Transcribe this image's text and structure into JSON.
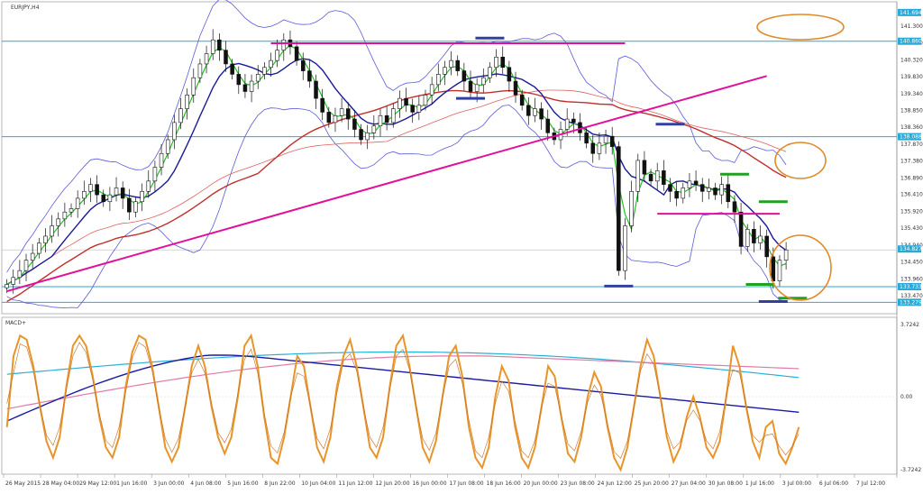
{
  "window": {
    "symbol_label": "EURJPY,H4",
    "macd_label": "MACD+"
  },
  "colors": {
    "up_candle": "#ffffff",
    "down_candle": "#111111",
    "bollinger": "#5a5adc",
    "ma_fast": "#22c022",
    "ma_mid": "#1a1a9a",
    "ma_slow": "#c0302a",
    "ma_slower": "#e06060",
    "trend_magenta": "#e0109a",
    "level_cyan": "#29a9d6",
    "ellipse_orange": "#e08a2a",
    "macd_orange": "#e8942a",
    "macd_blue": "#1a1aa0",
    "macd_cyan": "#29b0d6",
    "macd_pink": "#e07aa8"
  },
  "chart_data": [
    {
      "type": "line",
      "title": "EURJPY,H4",
      "price_axis_ticks": [
        "141.300",
        "140.810",
        "140.320",
        "139.830",
        "139.340",
        "138.850",
        "138.360",
        "137.870",
        "137.380",
        "136.890",
        "136.410",
        "135.920",
        "135.430",
        "134.940",
        "134.450",
        "133.960",
        "133.470"
      ],
      "price_tags": [
        "141.694",
        "140.860",
        "138.088",
        "134.827",
        "133.733",
        "133.279"
      ],
      "ylim": [
        133.0,
        141.9
      ],
      "time_axis_labels": [
        "26 May 2015",
        "28 May 04:00",
        "29 May 12:00",
        "1 Jun 16:00",
        "3 Jun 00:00",
        "4 Jun 08:00",
        "5 Jun 16:00",
        "8 Jun 22:00",
        "10 Jun 04:00",
        "11 Jun 12:00",
        "12 Jun 20:00",
        "16 Jun 00:00",
        "17 Jun 08:00",
        "18 Jun 16:00",
        "20 Jun 00:00",
        "23 Jun 08:00",
        "24 Jun 12:00",
        "25 Jun 20:00",
        "27 Jun 04:00",
        "30 Jun 08:00",
        "1 Jul 16:00",
        "3 Jul 00:00",
        "6 Jul 06:00",
        "7 Jul 12:00"
      ],
      "close_path": [
        133.8,
        134.0,
        134.2,
        134.5,
        134.7,
        135.0,
        135.2,
        135.5,
        135.7,
        135.9,
        136.0,
        136.3,
        136.5,
        136.7,
        136.4,
        136.2,
        136.4,
        136.6,
        136.3,
        135.9,
        136.2,
        136.5,
        136.8,
        137.2,
        137.6,
        138.0,
        138.5,
        138.9,
        139.3,
        139.8,
        140.2,
        140.5,
        140.9,
        140.6,
        140.2,
        139.9,
        139.6,
        139.4,
        139.7,
        139.9,
        140.1,
        140.3,
        140.6,
        140.9,
        140.7,
        140.3,
        140.0,
        139.7,
        139.2,
        138.8,
        138.5,
        138.7,
        138.9,
        138.6,
        138.3,
        138.0,
        138.2,
        138.4,
        138.7,
        138.5,
        138.9,
        139.2,
        139.0,
        138.8,
        139.0,
        139.3,
        139.6,
        139.9,
        140.1,
        140.3,
        140.0,
        139.7,
        139.4,
        139.6,
        139.8,
        140.1,
        140.4,
        140.1,
        139.7,
        139.3,
        139.0,
        138.7,
        138.9,
        138.6,
        138.2,
        138.0,
        138.3,
        138.6,
        138.5,
        138.2,
        137.9,
        137.6,
        137.9,
        138.1,
        137.8,
        134.2,
        135.5,
        136.5,
        137.4,
        137.0,
        136.8,
        137.1,
        136.7,
        136.5,
        136.3,
        136.6,
        136.8,
        136.7,
        136.5,
        136.6,
        136.4,
        136.7,
        136.2,
        135.9,
        134.9,
        135.4,
        135.0,
        135.2,
        134.6,
        133.9,
        134.5,
        134.8
      ],
      "series": [
        {
          "name": "",
          "kind": "bollinger_upper"
        },
        {
          "name": "",
          "kind": "bollinger_lower"
        },
        {
          "name": "",
          "kind": "ma_fast"
        },
        {
          "name": "",
          "kind": "ma_mid"
        },
        {
          "name": "",
          "kind": "ma_slow"
        },
        {
          "name": "",
          "kind": "ma_slower"
        }
      ],
      "annotations": {
        "resistance_levels": [
          140.86,
          138.088
        ],
        "support_levels": [
          133.733,
          133.279
        ],
        "trendline": {
          "from": [
            0,
            133.6
          ],
          "to": [
            118,
            139.85
          ]
        },
        "range_lines": [
          {
            "from": [
              41,
              140.8
            ],
            "to": [
              96,
              140.8
            ]
          },
          {
            "from": [
              101,
              135.85
            ],
            "to": [
              120,
              135.85
            ]
          }
        ]
      }
    },
    {
      "type": "line",
      "title": "MACD+",
      "ticks": [
        "3.7242",
        "0.00",
        "-3.7242"
      ],
      "ylim": [
        -3.7242,
        3.7242
      ],
      "oscillator": [
        -1.5,
        2.0,
        3.0,
        2.8,
        1.5,
        -0.5,
        -2.2,
        -3.0,
        -2.0,
        0.5,
        2.5,
        3.0,
        2.5,
        1.0,
        -1.0,
        -2.5,
        -3.0,
        -2.0,
        0.5,
        2.2,
        3.0,
        2.8,
        1.5,
        -0.5,
        -2.5,
        -3.2,
        -2.5,
        -0.5,
        1.5,
        2.5,
        1.5,
        -0.5,
        -2.0,
        -2.8,
        -2.0,
        0.0,
        2.5,
        3.0,
        1.5,
        -1.0,
        -3.0,
        -3.3,
        -2.0,
        0.0,
        2.0,
        1.5,
        -0.5,
        -2.5,
        -3.2,
        -2.0,
        0.5,
        2.0,
        2.8,
        1.5,
        -0.5,
        -2.5,
        -3.0,
        -2.0,
        0.5,
        2.5,
        3.0,
        1.5,
        -0.5,
        -2.5,
        -3.2,
        -2.2,
        0.0,
        2.0,
        2.5,
        1.0,
        -1.5,
        -3.0,
        -3.5,
        -2.5,
        0.0,
        1.5,
        0.8,
        -1.5,
        -3.0,
        -3.5,
        -2.5,
        -0.5,
        1.5,
        1.0,
        -1.0,
        -2.8,
        -3.2,
        -2.0,
        0.0,
        1.2,
        0.5,
        -1.5,
        -3.0,
        -3.6,
        -2.5,
        -0.5,
        1.5,
        2.8,
        2.0,
        0.0,
        -2.0,
        -3.2,
        -2.5,
        -1.0,
        0.0,
        -1.0,
        -2.5,
        -3.0,
        -2.2,
        0.0,
        2.5,
        1.5,
        -0.5,
        -2.2,
        -3.0,
        -1.5,
        -1.2,
        -2.8,
        -3.3,
        -2.5,
        -1.5
      ]
    }
  ]
}
